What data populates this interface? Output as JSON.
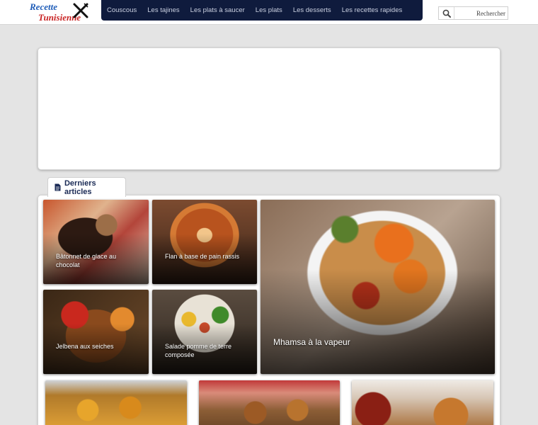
{
  "site": {
    "logo_line1": "Recette",
    "logo_line2": "Tunisienne",
    "logo_icon": "fork-knife-icon"
  },
  "nav": {
    "items": [
      "Couscous",
      "Les tajines",
      "Les plats à saucer",
      "Les plats",
      "Les desserts",
      "Les recettes rapides"
    ]
  },
  "search": {
    "placeholder": "Rechercher",
    "icon": "search-icon"
  },
  "recent": {
    "tab_label": "Derniers articles",
    "tab_icon": "document-icon",
    "articles": [
      {
        "title": "Bâtonnet de glace au chocolat"
      },
      {
        "title": "Flan à base de pain rassis"
      },
      {
        "title": "Mhamsa à la vapeur"
      },
      {
        "title": "Jelbena aux seiches"
      },
      {
        "title": "Salade pomme de terre composée"
      }
    ]
  },
  "colors": {
    "nav_bg": "#0f1b3d",
    "logo_blue": "#1e5cb8",
    "logo_red": "#c92323",
    "page_bg": "#e4e4e4"
  }
}
